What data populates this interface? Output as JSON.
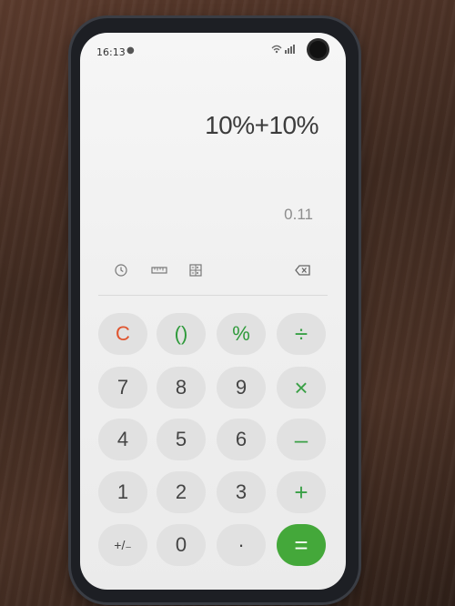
{
  "status_bar": {
    "time": "16:13",
    "notification_icon": "mic-icon",
    "signal_icons": "wifi-signal-icon"
  },
  "display": {
    "expression": "10%+10%",
    "result": "0.11"
  },
  "toolbar": {
    "history_icon": "history-clock-icon",
    "unit_converter_icon": "ruler-icon",
    "scientific_icon": "scientific-calculator-icon",
    "backspace_icon": "backspace-icon"
  },
  "keypad": {
    "clear": "C",
    "parentheses": "()",
    "percent": "%",
    "divide": "÷",
    "seven": "7",
    "eight": "8",
    "nine": "9",
    "multiply": "×",
    "four": "4",
    "five": "5",
    "six": "6",
    "minus": "–",
    "one": "1",
    "two": "2",
    "three": "3",
    "plus": "+",
    "sign": "+/₋",
    "zero": "0",
    "decimal": "·",
    "equals": "="
  },
  "colors": {
    "accent_green": "#44a83a",
    "clear_red": "#e0542e",
    "key_bg": "#e1e1e1"
  }
}
